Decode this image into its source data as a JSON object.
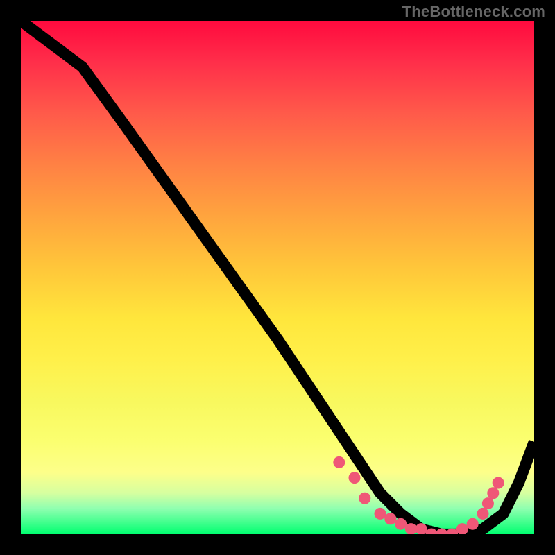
{
  "watermark": "TheBottleneck.com",
  "chart_data": {
    "type": "line",
    "title": "",
    "xlabel": "",
    "ylabel": "",
    "xlim": [
      0,
      100
    ],
    "ylim": [
      0,
      100
    ],
    "grid": false,
    "background": {
      "type": "vertical-gradient",
      "stops": [
        {
          "pct": 0,
          "color": "#ff0a3e"
        },
        {
          "pct": 18,
          "color": "#ff5a4a"
        },
        {
          "pct": 38,
          "color": "#ffa43e"
        },
        {
          "pct": 58,
          "color": "#ffe63c"
        },
        {
          "pct": 82,
          "color": "#fbff70"
        },
        {
          "pct": 95,
          "color": "#8fffb0"
        },
        {
          "pct": 100,
          "color": "#00ff70"
        }
      ]
    },
    "series": [
      {
        "name": "curve",
        "x": [
          0,
          4,
          8,
          12,
          20,
          30,
          40,
          50,
          58,
          62,
          66,
          70,
          74,
          78,
          82,
          86,
          90,
          94,
          97,
          100
        ],
        "y": [
          100,
          97,
          94,
          91,
          80,
          66,
          52,
          38,
          26,
          20,
          14,
          8,
          4,
          1,
          0,
          0,
          1,
          4,
          10,
          18
        ]
      }
    ],
    "markers": {
      "name": "highlight-dots",
      "color": "#ef5777",
      "points": [
        {
          "x": 62,
          "y": 14
        },
        {
          "x": 65,
          "y": 11
        },
        {
          "x": 67,
          "y": 7
        },
        {
          "x": 70,
          "y": 4
        },
        {
          "x": 72,
          "y": 3
        },
        {
          "x": 74,
          "y": 2
        },
        {
          "x": 76,
          "y": 1
        },
        {
          "x": 78,
          "y": 1
        },
        {
          "x": 80,
          "y": 0
        },
        {
          "x": 82,
          "y": 0
        },
        {
          "x": 84,
          "y": 0
        },
        {
          "x": 86,
          "y": 1
        },
        {
          "x": 88,
          "y": 2
        },
        {
          "x": 90,
          "y": 4
        },
        {
          "x": 91,
          "y": 6
        },
        {
          "x": 92,
          "y": 8
        },
        {
          "x": 93,
          "y": 10
        }
      ]
    }
  }
}
